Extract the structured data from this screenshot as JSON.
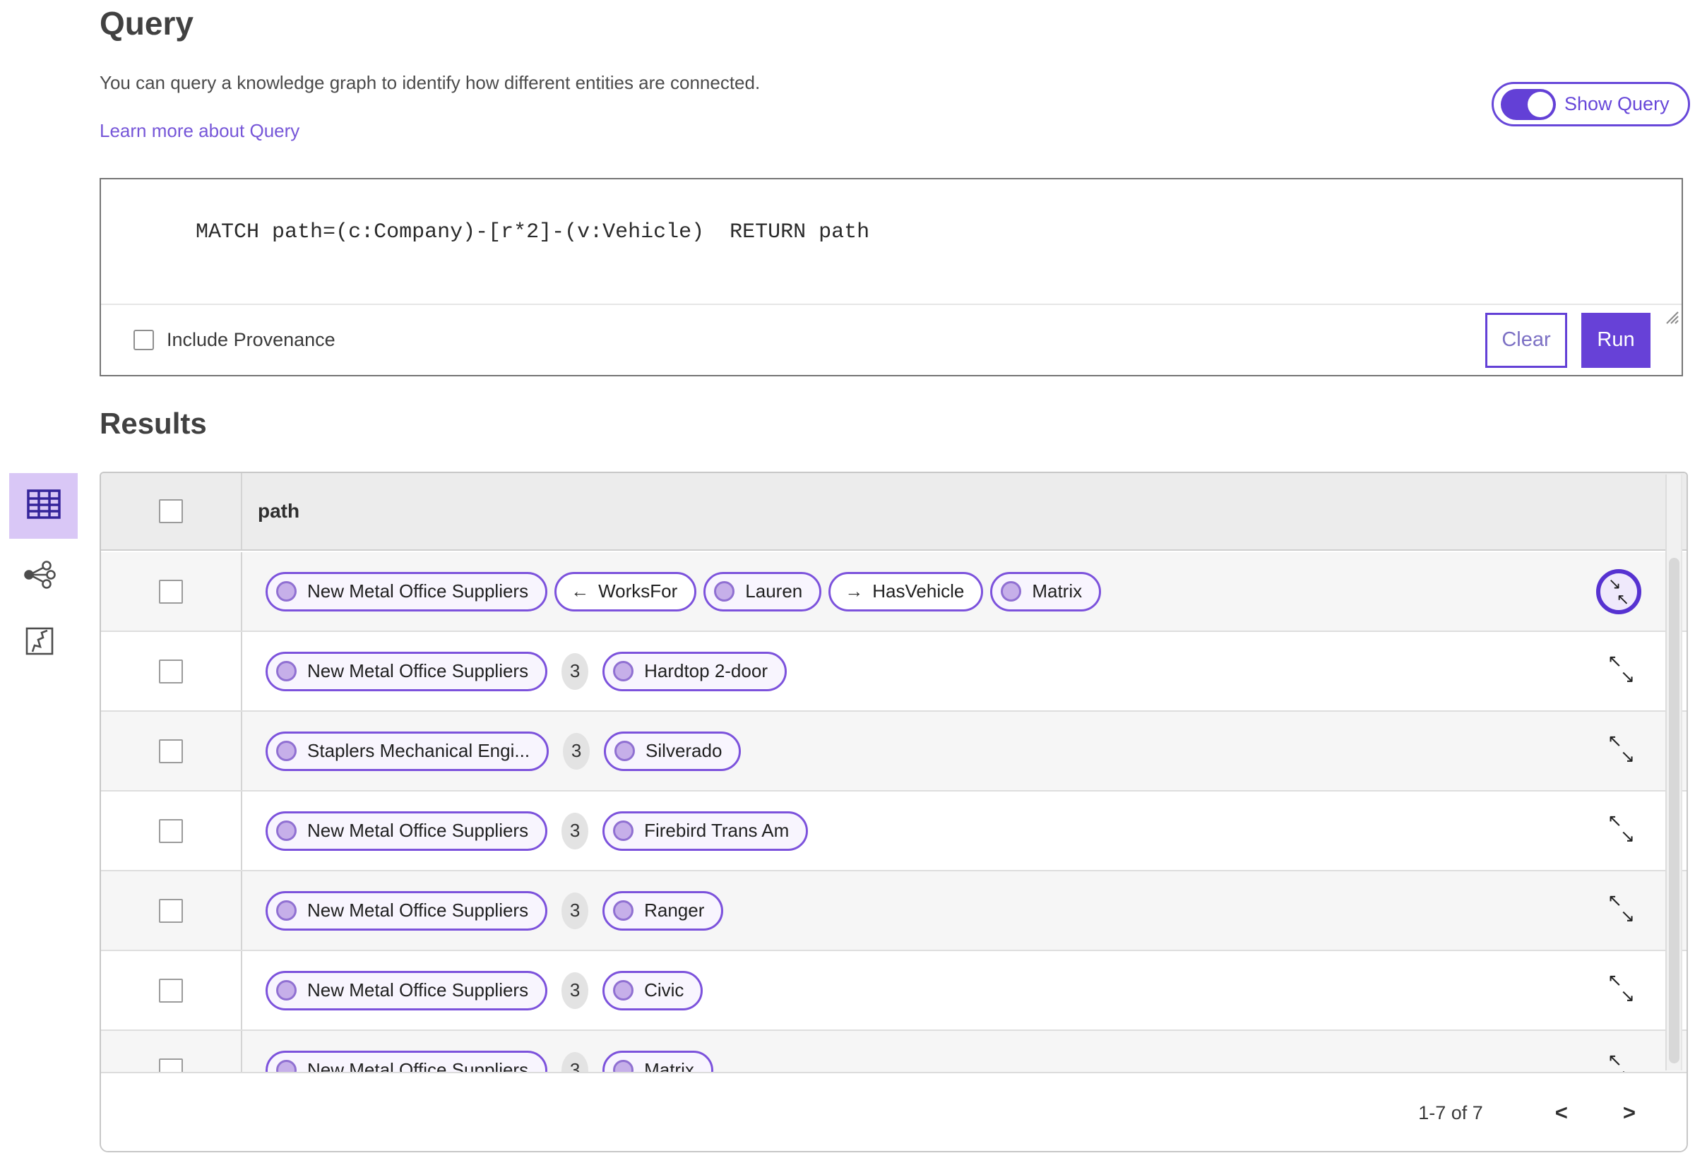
{
  "colors": {
    "accent_purple": "#6340d6",
    "pill_border": "#7c52dc",
    "pill_node_bg": "#f8f5fe",
    "pill_dot_fill": "#c6afe9",
    "link_purple": "#7656d8",
    "selected_view_bg": "#d9c7f6",
    "header_bg": "#ececec",
    "row_shade": "#f6f6f6",
    "count_badge_bg": "#e3e3e3"
  },
  "query_section": {
    "title": "Query",
    "description": "You can query a knowledge graph to identify how different entities are connected.",
    "learn_more_link": "Learn more about Query",
    "show_query_toggle": {
      "label": "Show Query",
      "state": "on"
    },
    "query_input": {
      "value": "MATCH path=(c:Company)-[r*2]-(v:Vehicle)  RETURN path"
    },
    "include_provenance": {
      "label": "Include Provenance",
      "checked": false
    },
    "buttons": {
      "clear": "Clear",
      "run": "Run"
    }
  },
  "results_section": {
    "title": "Results",
    "view_switcher": [
      {
        "name": "table-view",
        "selected": true
      },
      {
        "name": "graph-view",
        "selected": false
      },
      {
        "name": "map-view",
        "selected": false
      }
    ],
    "table": {
      "column_header": "path",
      "select_all_checked": false,
      "rows": [
        {
          "selected": false,
          "expand_button": {
            "style": "collapse-circled",
            "arrows": [
              "↘",
              "↖"
            ]
          },
          "cells": [
            {
              "type": "node",
              "label": "New Metal Office Suppliers"
            },
            {
              "type": "edge",
              "arrow": "←",
              "label": "WorksFor"
            },
            {
              "type": "node",
              "label": "Lauren"
            },
            {
              "type": "edge",
              "arrow": "→",
              "label": "HasVehicle"
            },
            {
              "type": "node",
              "label": "Matrix"
            }
          ]
        },
        {
          "selected": false,
          "expand_button": {
            "style": "expand",
            "arrows": [
              "↖",
              "↘"
            ]
          },
          "cells": [
            {
              "type": "node",
              "label": "New Metal Office Suppliers"
            },
            {
              "type": "count",
              "label": "3"
            },
            {
              "type": "node",
              "label": "Hardtop 2-door"
            }
          ]
        },
        {
          "selected": false,
          "expand_button": {
            "style": "expand",
            "arrows": [
              "↖",
              "↘"
            ]
          },
          "cells": [
            {
              "type": "node",
              "label": "Staplers Mechanical Engi..."
            },
            {
              "type": "count",
              "label": "3"
            },
            {
              "type": "node",
              "label": "Silverado"
            }
          ]
        },
        {
          "selected": false,
          "expand_button": {
            "style": "expand",
            "arrows": [
              "↖",
              "↘"
            ]
          },
          "cells": [
            {
              "type": "node",
              "label": "New Metal Office Suppliers"
            },
            {
              "type": "count",
              "label": "3"
            },
            {
              "type": "node",
              "label": "Firebird Trans Am"
            }
          ]
        },
        {
          "selected": false,
          "expand_button": {
            "style": "expand",
            "arrows": [
              "↖",
              "↘"
            ]
          },
          "cells": [
            {
              "type": "node",
              "label": "New Metal Office Suppliers"
            },
            {
              "type": "count",
              "label": "3"
            },
            {
              "type": "node",
              "label": "Ranger"
            }
          ]
        },
        {
          "selected": false,
          "expand_button": {
            "style": "expand",
            "arrows": [
              "↖",
              "↘"
            ]
          },
          "cells": [
            {
              "type": "node",
              "label": "New Metal Office Suppliers"
            },
            {
              "type": "count",
              "label": "3"
            },
            {
              "type": "node",
              "label": "Civic"
            }
          ]
        },
        {
          "selected": false,
          "expand_button": {
            "style": "expand",
            "arrows": [
              "↖",
              "↘"
            ]
          },
          "cells": [
            {
              "type": "node",
              "label": "New Metal Office Suppliers"
            },
            {
              "type": "count",
              "label": "3"
            },
            {
              "type": "node",
              "label": "Matrix"
            }
          ]
        }
      ]
    },
    "pagination": {
      "range_label": "1-7 of 7",
      "prev_label": "<",
      "next_label": ">"
    }
  }
}
